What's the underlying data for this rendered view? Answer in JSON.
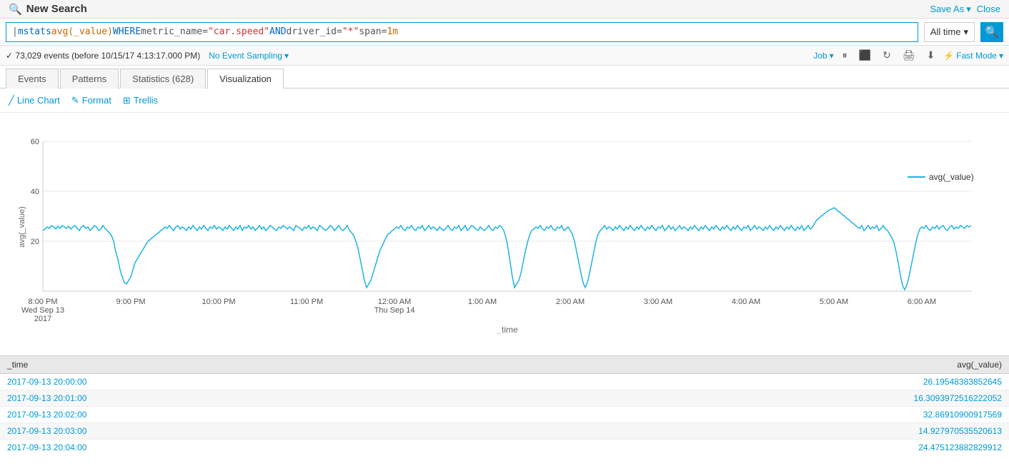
{
  "header": {
    "title": "New Search",
    "save_as_label": "Save As",
    "close_label": "Close"
  },
  "search_bar": {
    "query": "| mstats avg(_value) WHERE metric_name=\"car.speed\" AND driver_id=\"*\" span=1m",
    "query_parts": [
      {
        "text": "| ",
        "type": "pipe"
      },
      {
        "text": "mstats",
        "type": "keyword"
      },
      {
        "text": " avg(_value) ",
        "type": "func"
      },
      {
        "text": "WHERE",
        "type": "keyword"
      },
      {
        "text": " metric_name=",
        "type": "normal"
      },
      {
        "text": "\"car.speed\"",
        "type": "string"
      },
      {
        "text": " AND ",
        "type": "keyword"
      },
      {
        "text": "driver_id=",
        "type": "normal"
      },
      {
        "text": "\"*\"",
        "type": "string"
      },
      {
        "text": " span=",
        "type": "normal"
      },
      {
        "text": "1m",
        "type": "value"
      }
    ],
    "time_range": "All time",
    "search_placeholder": "Search"
  },
  "status_bar": {
    "events_text": "✓ 73,029 events (before 10/15/17 4:13:17.000 PM)",
    "no_event_sampling": "No Event Sampling",
    "job_label": "Job",
    "fast_mode_label": "Fast Mode"
  },
  "tabs": [
    {
      "label": "Events",
      "active": false
    },
    {
      "label": "Patterns",
      "active": false
    },
    {
      "label": "Statistics (628)",
      "active": false
    },
    {
      "label": "Visualization",
      "active": true
    }
  ],
  "viz_toolbar": {
    "line_chart_label": "Line Chart",
    "format_label": "Format",
    "trellis_label": "Trellis"
  },
  "chart": {
    "y_axis_label": "avg(_value)",
    "x_axis_label": "_time",
    "y_ticks": [
      "60",
      "40",
      "20"
    ],
    "x_ticks": [
      {
        "label": "8:00 PM",
        "sublabel": "Wed Sep 13",
        "sublabel2": "2017"
      },
      {
        "label": "9:00 PM",
        "sublabel": "",
        "sublabel2": ""
      },
      {
        "label": "10:00 PM",
        "sublabel": "",
        "sublabel2": ""
      },
      {
        "label": "11:00 PM",
        "sublabel": "",
        "sublabel2": ""
      },
      {
        "label": "12:00 AM",
        "sublabel": "Thu Sep 14",
        "sublabel2": ""
      },
      {
        "label": "1:00 AM",
        "sublabel": "",
        "sublabel2": ""
      },
      {
        "label": "2:00 AM",
        "sublabel": "",
        "sublabel2": ""
      },
      {
        "label": "3:00 AM",
        "sublabel": "",
        "sublabel2": ""
      },
      {
        "label": "4:00 AM",
        "sublabel": "",
        "sublabel2": ""
      },
      {
        "label": "5:00 AM",
        "sublabel": "",
        "sublabel2": ""
      },
      {
        "label": "6:00 AM",
        "sublabel": "",
        "sublabel2": ""
      }
    ],
    "legend_label": "avg(_value)"
  },
  "table": {
    "columns": [
      "_time",
      "avg(_value)"
    ],
    "rows": [
      {
        "time": "2017-09-13 20:00:00",
        "value": "26.19548383852645"
      },
      {
        "time": "2017-09-13 20:01:00",
        "value": "16.3093972516222052"
      },
      {
        "time": "2017-09-13 20:02:00",
        "value": "32.86910900917569"
      },
      {
        "time": "2017-09-13 20:03:00",
        "value": "14.927970535520613"
      },
      {
        "time": "2017-09-13 20:04:00",
        "value": "24.475123882829912"
      }
    ]
  }
}
